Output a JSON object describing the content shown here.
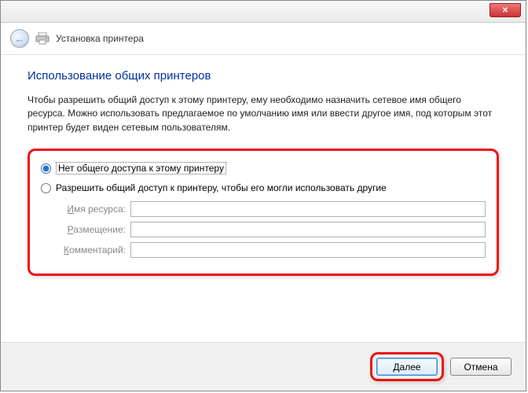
{
  "window": {
    "header_title": "Установка принтера"
  },
  "page": {
    "title": "Использование общих принтеров",
    "instruction": "Чтобы разрешить общий доступ к этому принтеру, ему необходимо назначить сетевое имя общего ресурса. Можно использовать предлагаемое по умолчанию имя или ввести другое имя, под которым этот принтер будет виден сетевым пользователям."
  },
  "options": {
    "no_share": "Нет общего доступа к этому принтеру",
    "share": "Разрешить общий доступ к принтеру, чтобы его могли использовать другие"
  },
  "fields": {
    "share_name": {
      "label_pre": "И",
      "label_rest": "мя ресурса:",
      "value": ""
    },
    "location": {
      "label_pre": "Р",
      "label_rest": "азмещение:",
      "value": ""
    },
    "comment": {
      "label_pre": "К",
      "label_rest": "омментарий:",
      "value": ""
    }
  },
  "footer": {
    "next": "Далее",
    "cancel": "Отмена"
  }
}
